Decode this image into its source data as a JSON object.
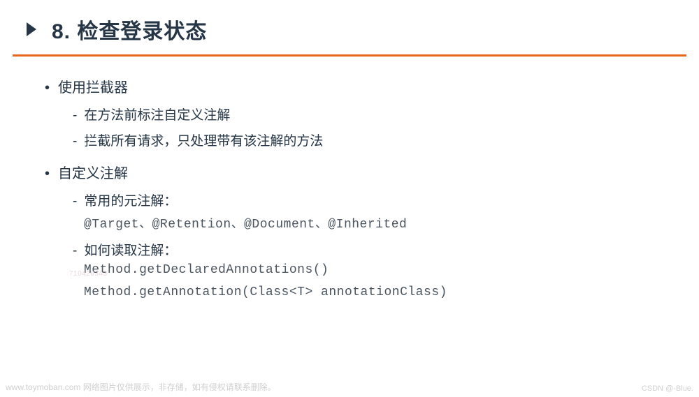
{
  "header": {
    "title": "8. 检查登录状态"
  },
  "sections": [
    {
      "label": "使用拦截器",
      "items": [
        {
          "text": "在方法前标注自定义注解"
        },
        {
          "text": "拦截所有请求，只处理带有该注解的方法"
        }
      ]
    },
    {
      "label": "自定义注解",
      "items": [
        {
          "text": "常用的元注解：",
          "code": "@Target、@Retention、@Document、@Inherited"
        },
        {
          "text": "如何读取注解：",
          "codes": [
            "Method.getDeclaredAnnotations()",
            "Method.getAnnotation(Class<T> annotationClass)"
          ]
        }
      ]
    }
  ],
  "footer": {
    "left": "www.toymoban.com 网络图片仅供展示，非存储，如有侵权请联系删除。",
    "right": "CSDN @-Blue."
  },
  "faint_id": "710426343"
}
